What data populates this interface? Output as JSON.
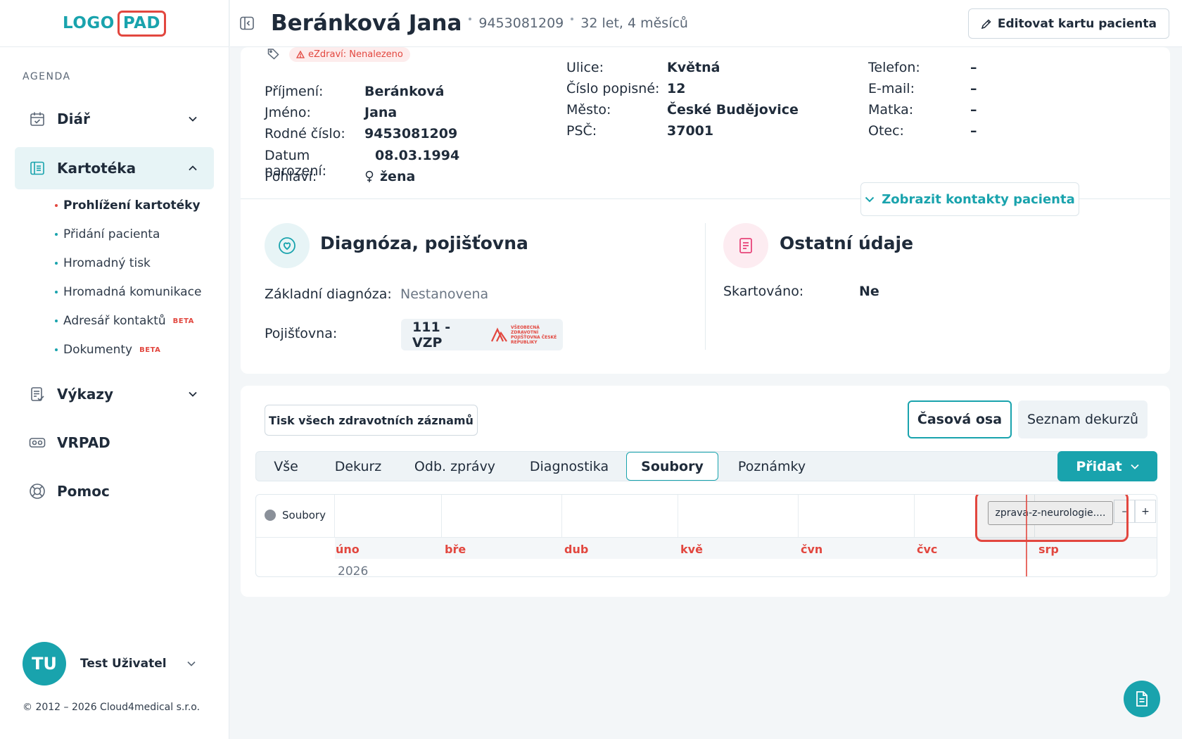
{
  "sidebar": {
    "logo": {
      "part1": "LOGO",
      "part2": "PAD"
    },
    "section_title": "AGENDA",
    "items": [
      {
        "label": "Diář",
        "icon": "calendar-icon"
      },
      {
        "label": "Kartotéka",
        "icon": "card-file-icon"
      },
      {
        "label": "Výkazy",
        "icon": "report-icon"
      },
      {
        "label": "VRPAD",
        "icon": "vr-headset-icon"
      },
      {
        "label": "Pomoc",
        "icon": "lifebuoy-icon"
      }
    ],
    "sub_items": [
      {
        "label": "Prohlížení kartotéky",
        "beta": ""
      },
      {
        "label": "Přidání pacienta",
        "beta": ""
      },
      {
        "label": "Hromadný tisk",
        "beta": ""
      },
      {
        "label": "Hromadná komunikace",
        "beta": ""
      },
      {
        "label": "Adresář kontaktů",
        "beta": "BETA"
      },
      {
        "label": "Dokumenty",
        "beta": "BETA"
      }
    ],
    "user": {
      "initials": "TU",
      "name": "Test Uživatel"
    },
    "copyright": "© 2012 – 2026 Cloud4medical s.r.o."
  },
  "header": {
    "patient_name": "Beránková Jana",
    "birth_number": "9453081209",
    "age": "32 let, 4 měsíců",
    "edit_label": "Editovat kartu pacienta"
  },
  "patient": {
    "ezdravi": "eZdraví: Nenalezeno",
    "personal": [
      {
        "k": "Příjmení:",
        "v": "Beránková"
      },
      {
        "k": "Jméno:",
        "v": "Jana"
      },
      {
        "k": "Rodné číslo:",
        "v": "9453081209"
      },
      {
        "k": "Datum narození:",
        "v": "08.03.1994"
      },
      {
        "k": "Pohlaví:",
        "v": "žena"
      }
    ],
    "address": [
      {
        "k": "Ulice:",
        "v": "Květná"
      },
      {
        "k": "Číslo popisné:",
        "v": "12"
      },
      {
        "k": "Město:",
        "v": "České Budějovice"
      },
      {
        "k": "PSČ:",
        "v": "37001"
      }
    ],
    "contact": [
      {
        "k": "Telefon:",
        "v": "–"
      },
      {
        "k": "E-mail:",
        "v": "–"
      },
      {
        "k": "Matka:",
        "v": "–"
      },
      {
        "k": "Otec:",
        "v": "–"
      }
    ],
    "contacts_button": "Zobrazit kontakty pacienta"
  },
  "diagnosis": {
    "title": "Diagnóza, pojišťovna",
    "base_label": "Základní diagnóza:",
    "base_value": "Nestanovena",
    "insurance_label": "Pojišťovna:",
    "insurance_code": "111 - VZP",
    "insurance_logo_text": "VŠEOBECNÁ ZDRAVOTNÍ POJIŠŤOVNA ČESKÉ REPUBLIKY"
  },
  "other": {
    "title": "Ostatní údaje",
    "shredded_label": "Skartováno:",
    "shredded_value": "Ne"
  },
  "records": {
    "print_all": "Tisk všech zdravotních záznamů",
    "view_timeline": "Časová osa",
    "view_list": "Seznam dekurzů",
    "tabs": [
      "Vše",
      "Dekurz",
      "Odb. zprávy",
      "Diagnostika",
      "Soubory",
      "Poznámky"
    ],
    "active_tab": "Soubory",
    "add_label": "Přidat"
  },
  "timeline": {
    "group_label": "Soubory",
    "months": [
      "úno",
      "bře",
      "dub",
      "kvě",
      "čvn",
      "čvc",
      "srp"
    ],
    "year": "2026",
    "item_label": "zprava-z-neurologie....",
    "zoom_out": "–",
    "zoom_in": "+"
  },
  "colors": {
    "accent": "#19a3ad",
    "alert": "#e2473f"
  }
}
